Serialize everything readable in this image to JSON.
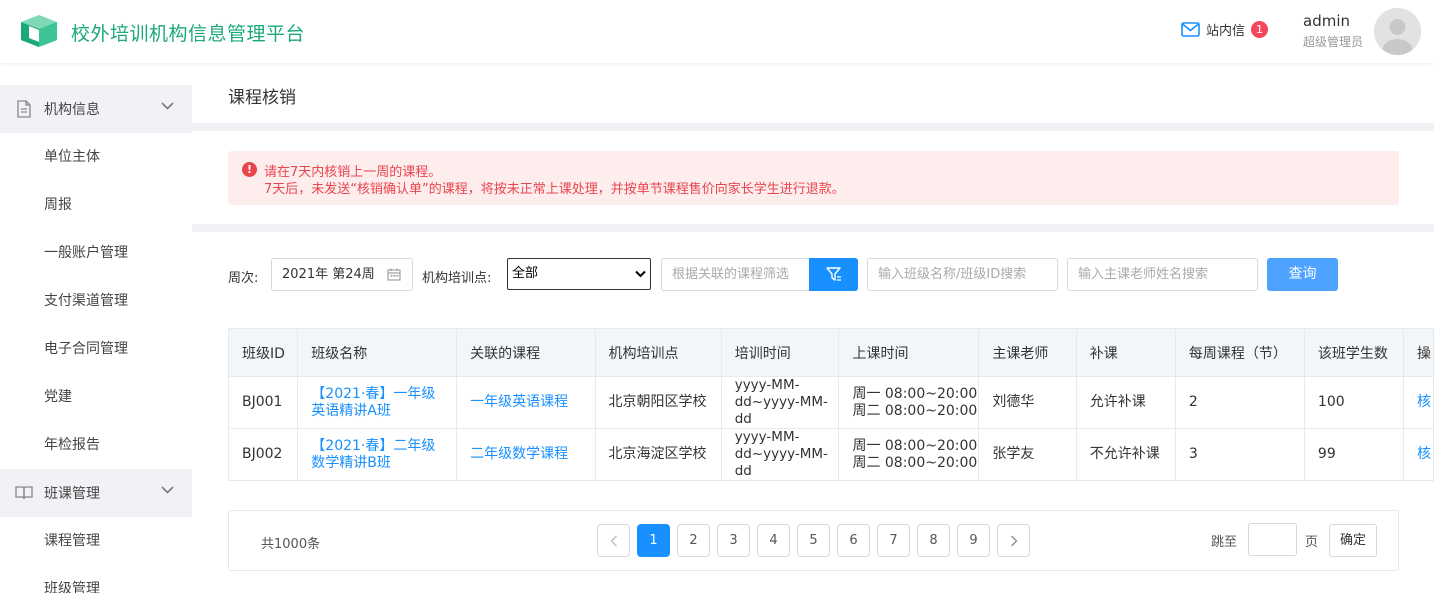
{
  "header": {
    "app_title": "校外培训机构信息管理平台",
    "messages_label": "站内信",
    "messages_count": "1",
    "user_name": "admin",
    "user_role": "超级管理员",
    "brand_color": "#1aa97b"
  },
  "sidebar": {
    "groups": [
      {
        "label": "机构信息",
        "icon": "document-icon",
        "items": [
          "单位主体",
          "周报",
          "一般账户管理",
          "支付渠道管理",
          "电子合同管理",
          "党建",
          "年检报告"
        ]
      },
      {
        "label": "班课管理",
        "icon": "book-icon",
        "items": [
          "课程管理",
          "班级管理"
        ]
      }
    ]
  },
  "page": {
    "title": "课程核销",
    "alert_line1": "请在7天内核销上一周的课程。",
    "alert_line2": "7天后，未发送“核销确认单”的课程，将按未正常上课处理，并按单节课程售价向家长学生进行退款。"
  },
  "filters": {
    "week_label": "周次:",
    "week_value": "2021年 第24周",
    "site_label": "机构培训点:",
    "site_value": "全部",
    "course_placeholder": "根据关联的课程筛选",
    "class_placeholder": "输入班级名称/班级ID搜索",
    "teacher_placeholder": "输入主课老师姓名搜索",
    "query_label": "查询"
  },
  "table": {
    "columns": [
      "班级ID",
      "班级名称",
      "关联的课程",
      "机构培训点",
      "培训时间",
      "上课时间",
      "主课老师",
      "补课",
      "每周课程（节）",
      "该班学生数",
      "操"
    ],
    "rows": [
      {
        "id": "BJ001",
        "name_line1": "【2021·春】一年级",
        "name_line2": "英语精讲A班",
        "course": "一年级英语课程",
        "site": "北京朝阳区学校",
        "train_time": "yyyy-MM-dd~yyyy-MM-dd",
        "class_time_line1": "周一 08:00~20:00",
        "class_time_line2": "周二 08:00~20:00",
        "teacher": "刘德华",
        "makeup": "允许补课",
        "weekly": "2",
        "students": "100",
        "op": "核"
      },
      {
        "id": "BJ002",
        "name_line1": "【2021·春】二年级",
        "name_line2": "数学精讲B班",
        "course": "二年级数学课程",
        "site": "北京海淀区学校",
        "train_time": "yyyy-MM-dd~yyyy-MM-dd",
        "class_time_line1": "周一 08:00~20:00",
        "class_time_line2": "周二 08:00~20:00",
        "teacher": "张学友",
        "makeup": "不允许补课",
        "weekly": "3",
        "students": "99",
        "op": "核"
      }
    ]
  },
  "pagination": {
    "total": "共1000条",
    "pages": [
      "1",
      "2",
      "3",
      "4",
      "5",
      "6",
      "7",
      "8",
      "9"
    ],
    "current": "1",
    "jump_label": "跳至",
    "page_unit": "页",
    "confirm_label": "确定"
  }
}
